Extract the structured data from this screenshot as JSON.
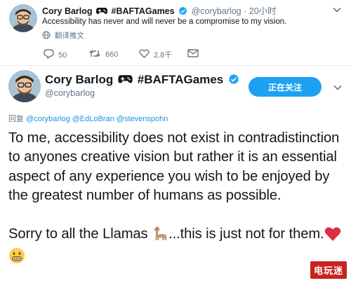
{
  "colors": {
    "accent": "#1da1f2",
    "muted": "#657786",
    "text": "#14171a",
    "watermark_bg": "#c8241f"
  },
  "quoted_tweet": {
    "name": "Cory Barlog",
    "hashtag": "#BAFTAGames",
    "handle": "@corybarlog",
    "separator": "·",
    "time": "20小时",
    "text": "Accessibility has never and will never be a compromise to my vision.",
    "translate_label": "翻译推文",
    "actions": {
      "replies": "50",
      "retweets": "660",
      "likes": "2.8千"
    }
  },
  "main_tweet": {
    "name": "Cory Barlog",
    "hashtag": "#BAFTAGames",
    "handle": "@corybarlog",
    "follow_label": "正在关注",
    "reply_prefix": "回复",
    "reply_mentions": "@corybarlog @EdLoBran @stevenspohn",
    "paragraph_1": "To me, accessibility does not exist in contradistinction to anyones creative vision but rather it is an essential aspect of any experience you wish to be enjoyed by the greatest number of humans as possible.",
    "paragraph_2_part_1": "Sorry to all the Llamas ",
    "paragraph_2_part_2": "...this is just not for them.",
    "emojis": [
      "llama-emoji",
      "red-heart-emoji",
      "grimacing-face-emoji"
    ]
  },
  "watermark": {
    "text": "电玩迷"
  },
  "icons": [
    "gamepad-icon",
    "verified-badge-icon",
    "chevron-down-icon",
    "globe-icon",
    "reply-icon",
    "retweet-icon",
    "like-icon",
    "direct-message-icon"
  ]
}
